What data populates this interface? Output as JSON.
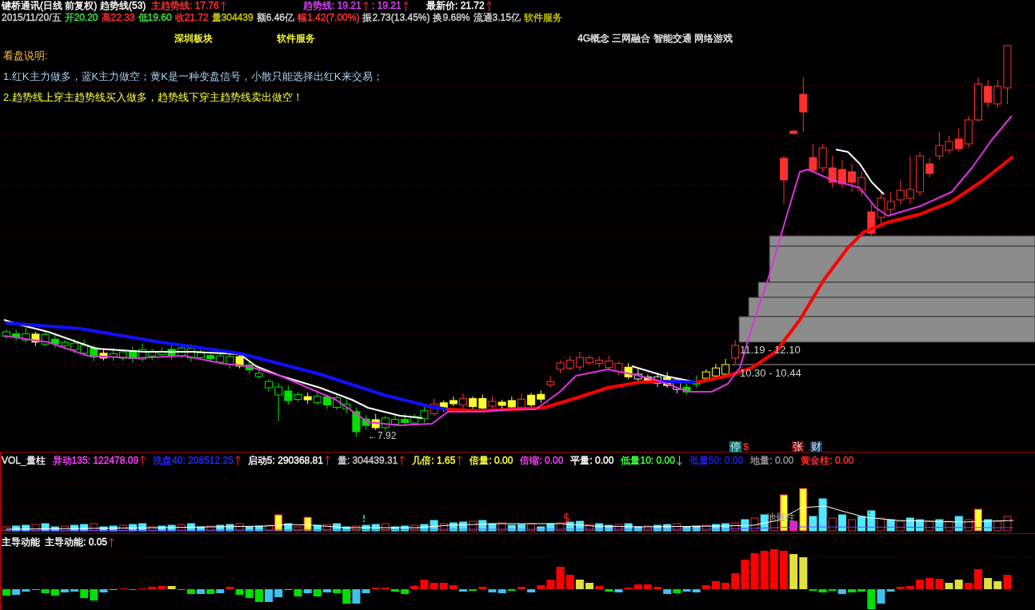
{
  "header": {
    "line_1": [
      {
        "text": "键桥通讯(日线 前复权)",
        "color": "#ffffff"
      },
      {
        "text": "趋势线(53)",
        "color": "#ffffff"
      },
      {
        "text": "主趋势线: 17.76",
        "color": "#ff3232",
        "rising": true
      },
      {
        "text": "趋势线: 19.21",
        "color": "#e040ff",
        "rising": true
      },
      {
        "text": ": 19.21",
        "color": "#e040ff",
        "rising": true
      },
      {
        "text": "最新价: 21.72",
        "color": "#ffffff",
        "rising": true
      }
    ],
    "line_2": [
      {
        "text": "2015/11/20/五",
        "color": "#d0d0d0"
      },
      {
        "text": "开20.20",
        "color": "#40e040"
      },
      {
        "text": "高22.33",
        "color": "#ff3232"
      },
      {
        "text": "低19.60",
        "color": "#40e040"
      },
      {
        "text": "收21.72",
        "color": "#ff3232"
      },
      {
        "text": "量304439",
        "color": "#c8c800"
      },
      {
        "text": "额6.46亿",
        "color": "#d0d0d0"
      },
      {
        "text": "幅1.42(7.00%)",
        "color": "#ff3232"
      },
      {
        "text": "振2.73(13.45%)",
        "color": "#d0d0d0"
      },
      {
        "text": "换9.68%",
        "color": "#d0d0d0"
      },
      {
        "text": "流通3.15亿",
        "color": "#d0d0d0"
      },
      {
        "text": "软件服务",
        "color": "#c8c800"
      }
    ]
  },
  "sector_tags": [
    {
      "text": "深圳板块",
      "color": "#ffff40"
    },
    {
      "text": "软件服务",
      "color": "#ffff40"
    },
    {
      "text": "4G概念 三网融合 智能交通 网络游戏",
      "color": "#e8e8e8"
    }
  ],
  "notes": {
    "title": "看盘说明:",
    "lines": [
      {
        "text": "1.红K主力做多，蓝K主力做空；黄K是一种变盘信号，小散只能选择出红K来交易；",
        "color": "#a8d0f0"
      },
      {
        "text": "2.趋势线上穿主趋势线买入做多，趋势线下穿主趋势线卖出做空！",
        "color": "#ffff40"
      }
    ]
  },
  "price_chart": {
    "range_labels": [
      "11.19 - 12.10",
      "10.30 - 10.44"
    ],
    "low_marker": "←7.92",
    "event_markers": [
      {
        "kind": "badge",
        "text": "停",
        "color": "#007878"
      },
      {
        "kind": "glyph",
        "text": "$",
        "color": "#ff2020"
      },
      {
        "kind": "badge",
        "text": "张",
        "color": "#7a0000"
      },
      {
        "kind": "badge",
        "text": "财",
        "color": "#103860"
      }
    ]
  },
  "volume_panel": {
    "readouts": [
      {
        "text": "VOL_量柱",
        "color": "#e8e8e8"
      },
      {
        "text": "异动135: 122478.09",
        "color": "#ff40ff",
        "rising": true
      },
      {
        "text": "洗盘40: 208512.25",
        "color": "#2828ff",
        "rising": true
      },
      {
        "text": "启动5: 290368.81",
        "color": "#ffffff",
        "rising": true
      },
      {
        "text": "量: 304439.31",
        "color": "#c8c8c8",
        "rising": true
      },
      {
        "text": "几倍: 1.65",
        "color": "#ffff30",
        "rising": true
      },
      {
        "text": "倍量: 0.00",
        "color": "#ffff30"
      },
      {
        "text": "倍缩: 0.00",
        "color": "#ff40ff"
      },
      {
        "text": "平量: 0.00",
        "color": "#ffffff"
      },
      {
        "text": "低量10: 0.00",
        "color": "#40ff40",
        "rising": false
      },
      {
        "text": "低量50: 0.00",
        "color": "#2020e0"
      },
      {
        "text": "地量: 0.00",
        "color": "#909090"
      },
      {
        "text": "黄金柱: 0.00",
        "color": "#ff3030"
      }
    ],
    "annotation": "地量柱"
  },
  "momentum_panel": {
    "readouts": [
      {
        "text": "主导动能",
        "color": "#ffffff"
      },
      {
        "text": "主导动能: 0.05",
        "color": "#ffffff",
        "rising": true
      }
    ]
  }
}
